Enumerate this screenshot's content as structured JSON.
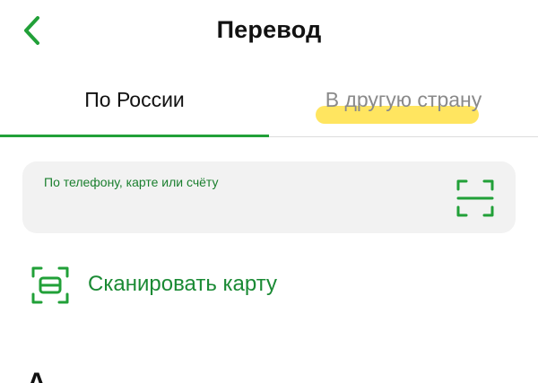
{
  "header": {
    "title": "Перевод"
  },
  "tabs": [
    {
      "label": "По России",
      "active": true
    },
    {
      "label": "В другую страну",
      "active": false
    }
  ],
  "search": {
    "label": "По телефону, карте или счёту"
  },
  "scan_card": {
    "label": "Сканировать карту"
  },
  "partial_heading": "А",
  "colors": {
    "accent": "#21a038",
    "accent_text": "#1a8a34",
    "highlight": "#ffe044",
    "card_bg": "#f2f2f2",
    "inactive_tab": "#8a8a8a"
  },
  "icons": {
    "back": "chevron-left-icon",
    "qr_scan": "scan-frame-icon",
    "card_scan": "card-scan-icon"
  }
}
